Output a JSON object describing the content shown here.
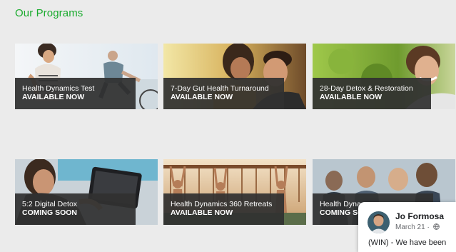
{
  "page": {
    "title": "Our Programs"
  },
  "programs": [
    {
      "title": "Health Dynamics Test",
      "status": "AVAILABLE NOW"
    },
    {
      "title": "7-Day Gut Health Turnaround",
      "status": "AVAILABLE NOW"
    },
    {
      "title": "28-Day Detox & Restoration",
      "status": "AVAILABLE NOW"
    },
    {
      "title": "5:2 Digital Detox",
      "status": "COMING SOON"
    },
    {
      "title": "Health Dynamics 360 Retreats",
      "status": "AVAILABLE NOW"
    },
    {
      "title": "Health Dyna",
      "status": "COMING SO"
    }
  ],
  "notification": {
    "name": "Jo Formosa",
    "date": "March 21 ·",
    "snippet": "(WIN) - We have been"
  },
  "colors": {
    "title_green": "#1aab2e",
    "caption_bg": "#303030"
  },
  "icons": {
    "privacy": "globe-icon"
  }
}
